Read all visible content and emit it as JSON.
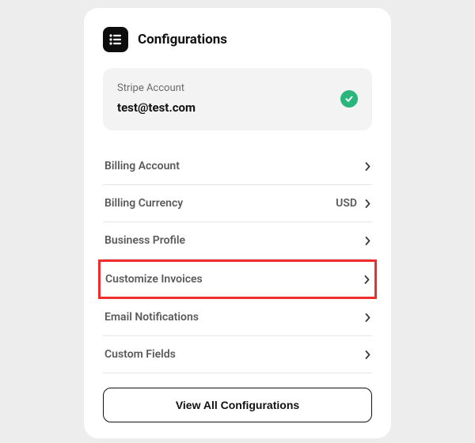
{
  "header": {
    "icon": "configurations-icon",
    "title": "Configurations"
  },
  "account": {
    "label": "Stripe Account",
    "email": "test@test.com",
    "status_icon": "checkmark-icon"
  },
  "settings": [
    {
      "id": "billing-account",
      "label": "Billing Account",
      "value": "",
      "highlighted": false
    },
    {
      "id": "billing-currency",
      "label": "Billing Currency",
      "value": "USD",
      "highlighted": false
    },
    {
      "id": "business-profile",
      "label": "Business Profile",
      "value": "",
      "highlighted": false
    },
    {
      "id": "customize-invoices",
      "label": "Customize Invoices",
      "value": "",
      "highlighted": true
    },
    {
      "id": "email-notifications",
      "label": "Email Notifications",
      "value": "",
      "highlighted": false
    },
    {
      "id": "custom-fields",
      "label": "Custom Fields",
      "value": "",
      "highlighted": false
    }
  ],
  "footer": {
    "view_all_label": "View All Configurations"
  },
  "colors": {
    "page_bg": "#ededed",
    "card_bg": "#ffffff",
    "box_bg": "#f3f3f3",
    "text_primary": "#121212",
    "text_secondary": "#5a5a5a",
    "text_muted": "#6b6b6b",
    "divider": "#e5e5e5",
    "highlight_border": "#ef2d2d",
    "status_green": "#2ab57d"
  }
}
